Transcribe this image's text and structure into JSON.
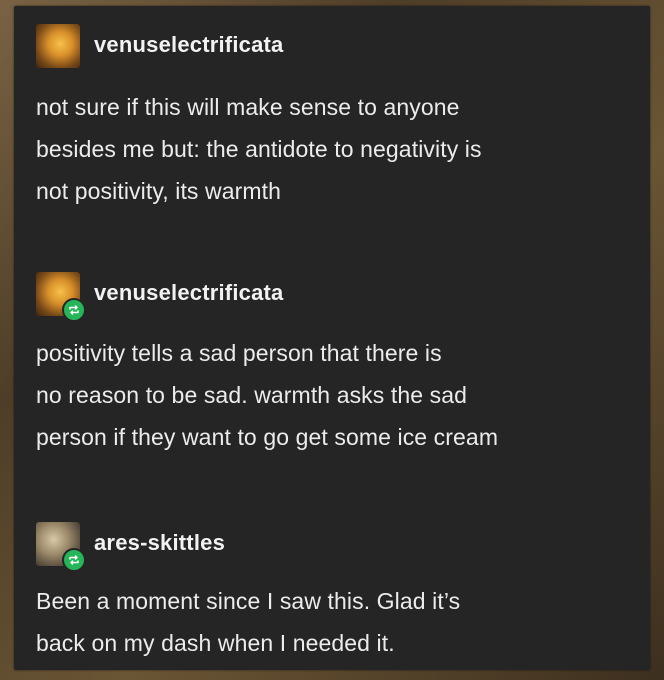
{
  "posts": [
    {
      "username": "venuselectrificata",
      "avatar_icon": "sunset-avatar-icon",
      "reblog": false,
      "lines": [
        "not sure if this will make sense to anyone",
        "besides me but: the antidote to negativity is",
        "not positivity, its warmth"
      ]
    },
    {
      "username": "venuselectrificata",
      "avatar_icon": "sunset-avatar-icon",
      "reblog": true,
      "lines": [
        "positivity tells a sad person that there is",
        "no reason to be sad. warmth asks the sad",
        "person if they want to go get some ice cream"
      ]
    },
    {
      "username": "ares-skittles",
      "avatar_icon": "character-avatar-icon",
      "reblog": true,
      "lines": [
        "Been a moment since I saw this. Glad it’s",
        "back on my dash when I needed it."
      ]
    }
  ],
  "colors": {
    "card_background": "#252525",
    "text": "#ececec",
    "username": "#f2f2f2",
    "reblog_badge": "#27b559"
  }
}
